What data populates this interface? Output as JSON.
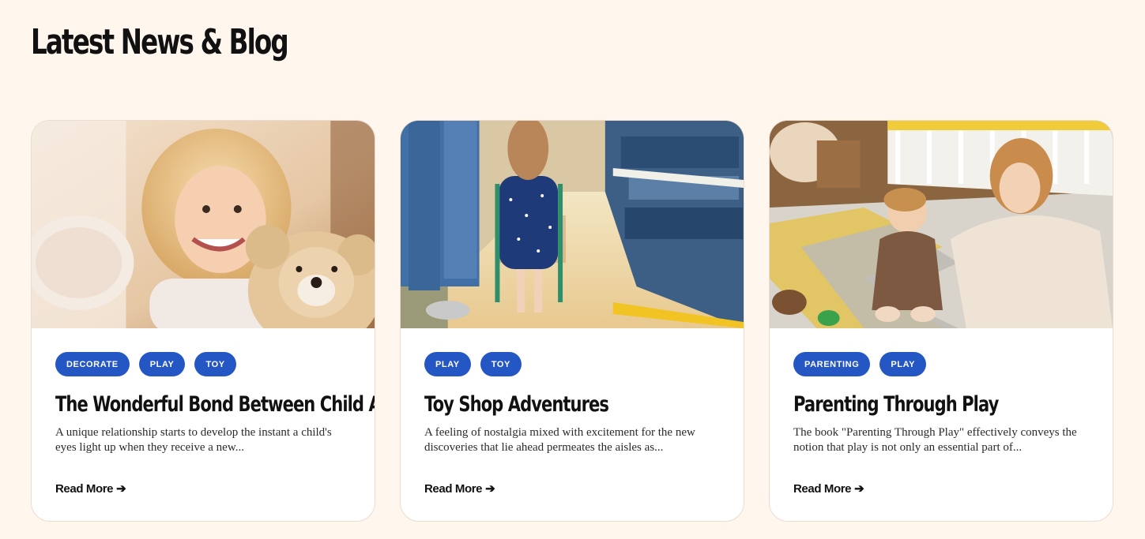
{
  "section": {
    "title": "Latest News & Blog"
  },
  "cards": [
    {
      "image_name": "girl-with-teddy-bear-image",
      "tags": [
        "DECORATE",
        "PLAY",
        "TOY"
      ],
      "title": "The Wonderful Bond Between Child And Toy",
      "excerpt": "A unique relationship starts to develop the instant a child's eyes light up when they receive a new...",
      "read_more": "Read More",
      "read_more_icon": "arrow-right-icon"
    },
    {
      "image_name": "toy-shop-aisle-image",
      "tags": [
        "PLAY",
        "TOY"
      ],
      "title": "Toy Shop Adventures",
      "excerpt": "A feeling of nostalgia mixed with excitement for the new discoveries that lie ahead permeates the aisles as...",
      "read_more": "Read More",
      "read_more_icon": "arrow-right-icon"
    },
    {
      "image_name": "mother-and-baby-playing-image",
      "tags": [
        "PARENTING",
        "PLAY"
      ],
      "title": "Parenting Through Play",
      "excerpt": "The book \"Parenting Through Play\" effectively conveys the notion that play is not only an essential part of...",
      "read_more": "Read More",
      "read_more_icon": "arrow-right-icon"
    }
  ],
  "colors": {
    "page_background": "#fff6ee",
    "tag_background": "#2456c4",
    "tag_text": "#ffffff",
    "card_background": "#ffffff"
  }
}
